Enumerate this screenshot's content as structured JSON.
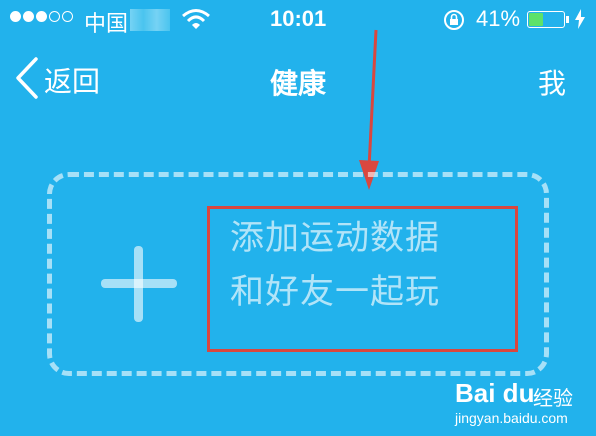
{
  "status_bar": {
    "carrier": "中国",
    "time": "10:01",
    "battery_percent": "41%",
    "battery_level": 0.41,
    "signal_bars_filled": 3,
    "signal_bars_total": 5
  },
  "nav": {
    "back_label": "返回",
    "title": "健康",
    "me_label": "我"
  },
  "card": {
    "line1": "添加运动数据",
    "line2": "和好友一起玩"
  },
  "watermark": {
    "logo": "Bai du",
    "text": "经验",
    "url": "jingyan.baidu.com"
  },
  "colors": {
    "background": "#22b2ec",
    "annotation": "#d9473f",
    "battery": "#5de26a"
  }
}
